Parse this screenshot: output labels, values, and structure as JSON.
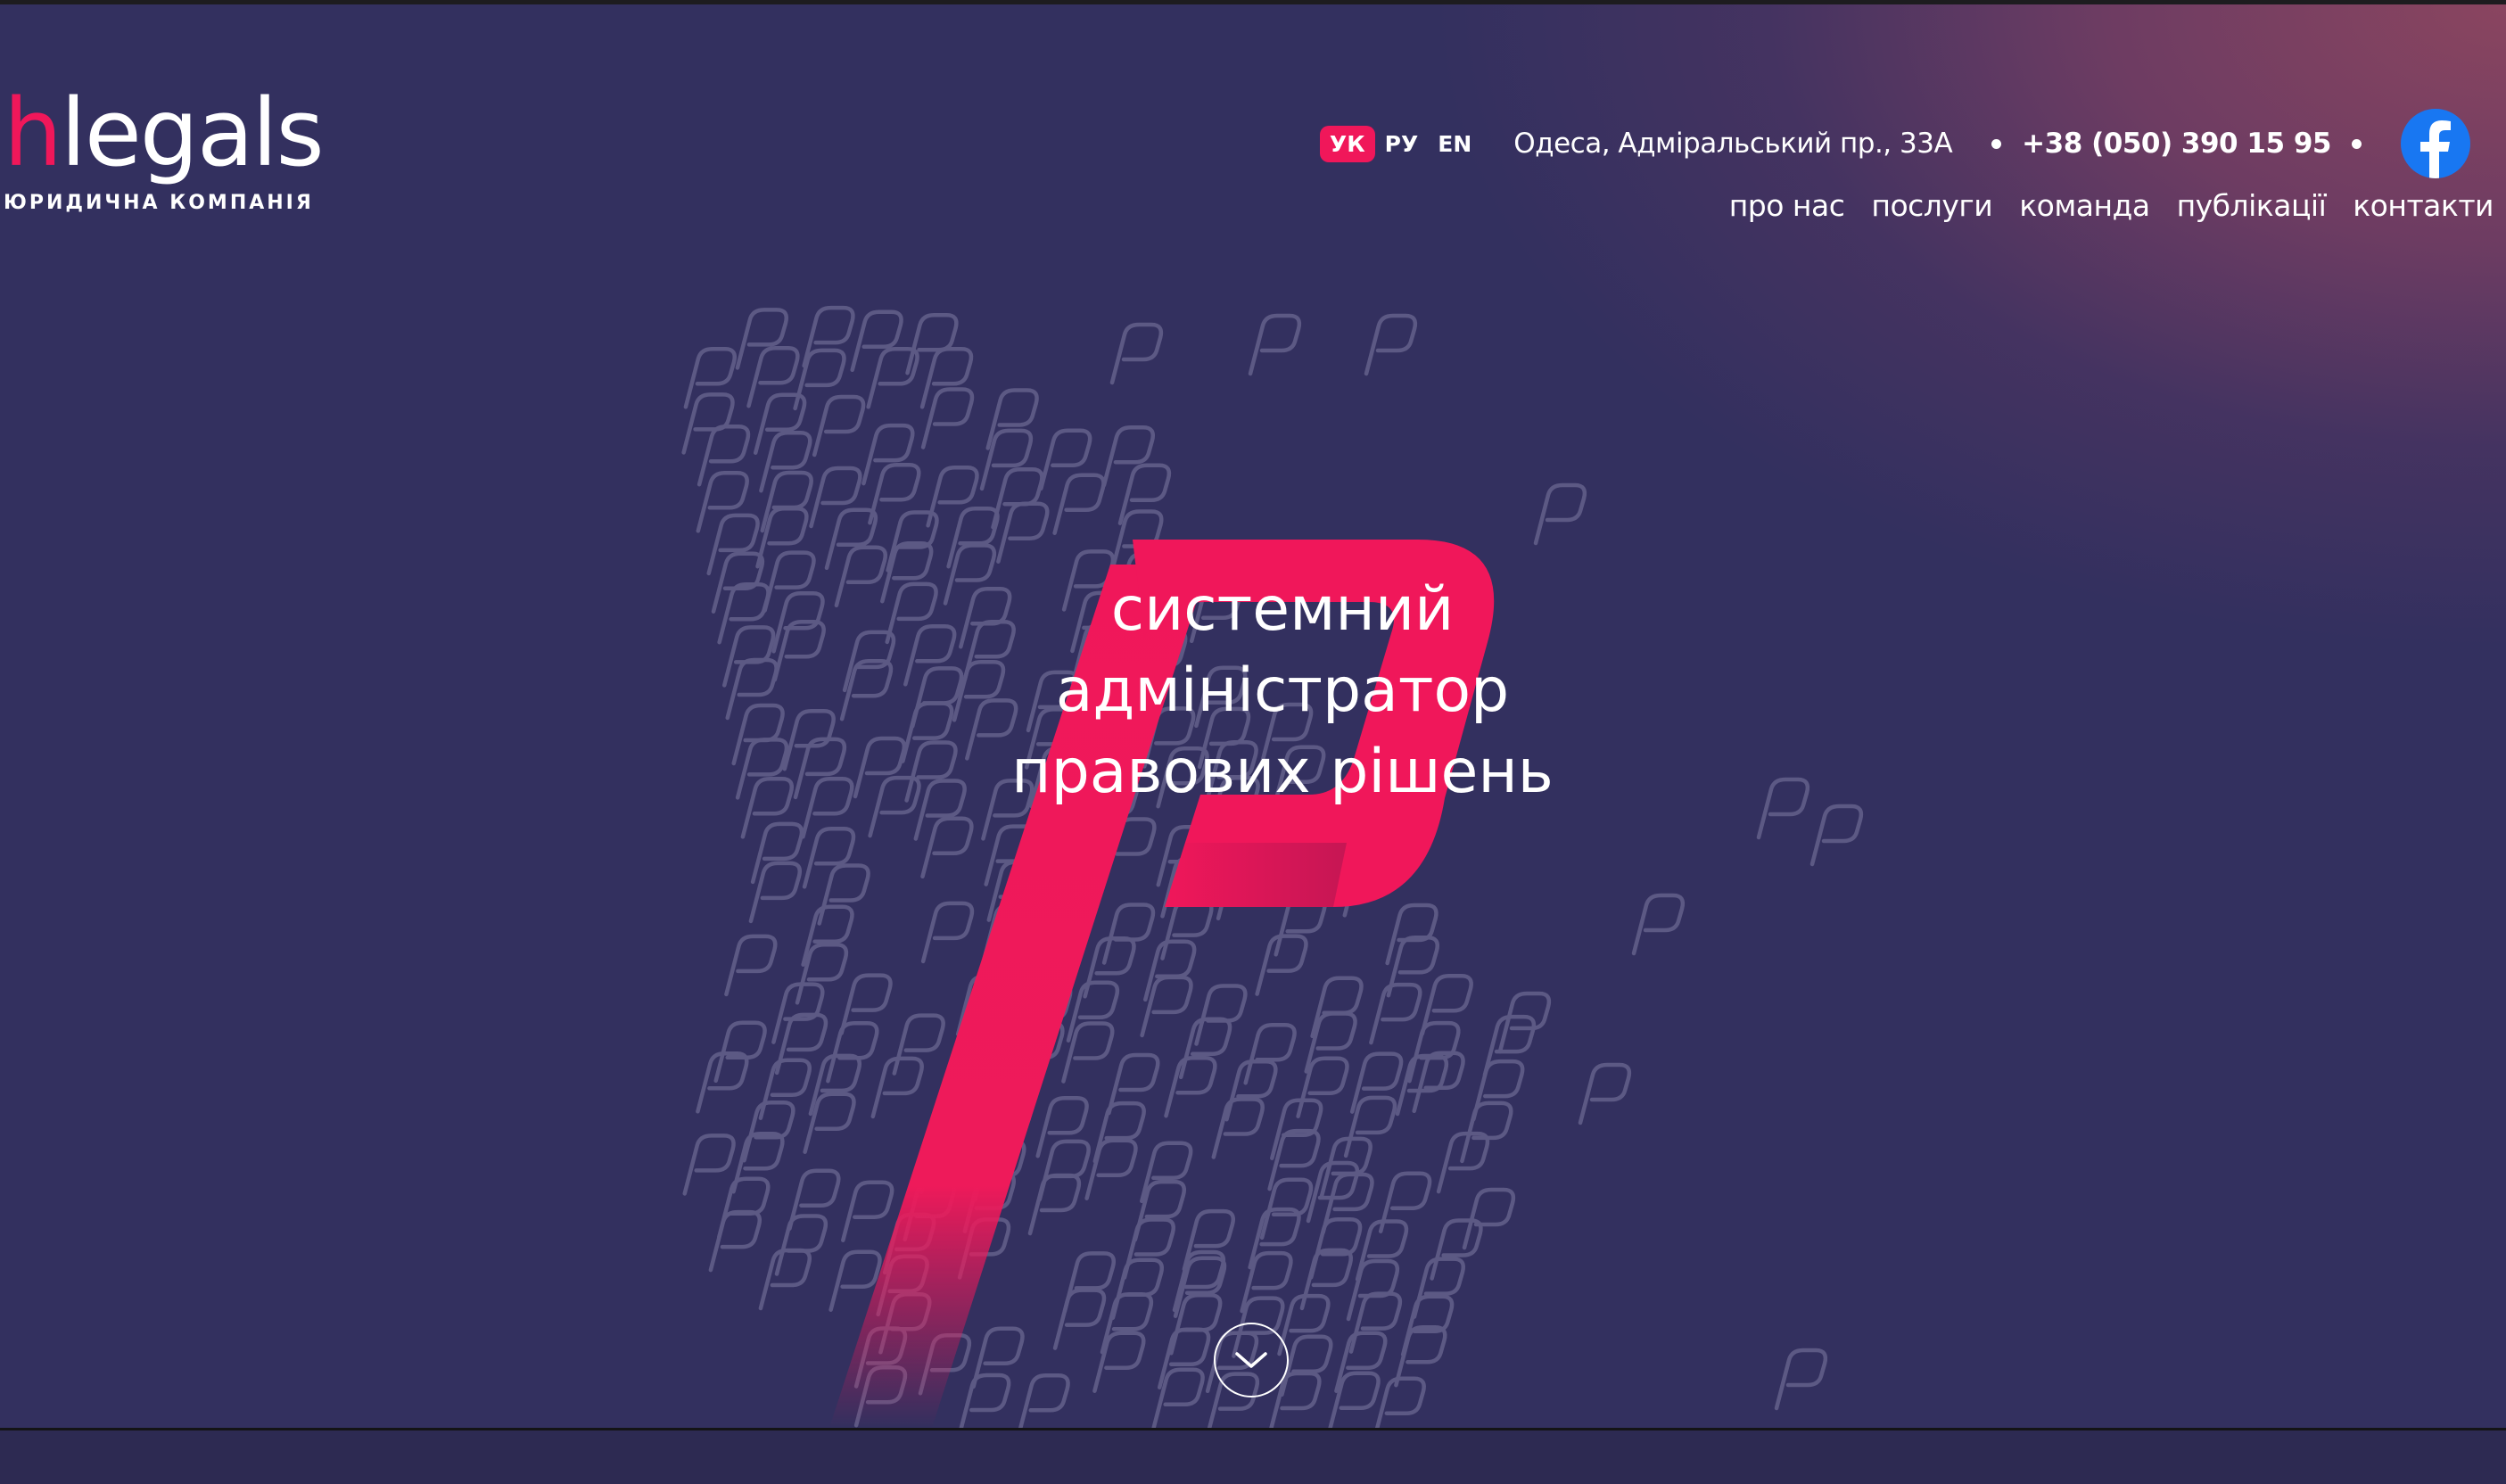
{
  "logo": {
    "accent": "h",
    "word": "legals",
    "subtitle": "ЮРИДИЧНА КОМПАНІЯ",
    "accent_color": "#f0175a"
  },
  "header": {
    "languages": [
      {
        "label": "УК",
        "active": true
      },
      {
        "label": "РУ",
        "active": false
      },
      {
        "label": "EN",
        "active": false
      }
    ],
    "address": "Одеса, Адміральський пр., 33А",
    "phone": "+38 (050) 390 15 95",
    "social_icon": "facebook-icon",
    "social_color": "#1877f2"
  },
  "nav": {
    "items": [
      "про нас",
      "послуги",
      "команда",
      "публікації",
      "контакти"
    ]
  },
  "hero": {
    "headline": [
      "системний",
      "адміністратор",
      "правових рішень"
    ],
    "scroll_icon": "chevron-down-icon",
    "background_color": "#33305f",
    "brand_color": "#f0175a"
  }
}
